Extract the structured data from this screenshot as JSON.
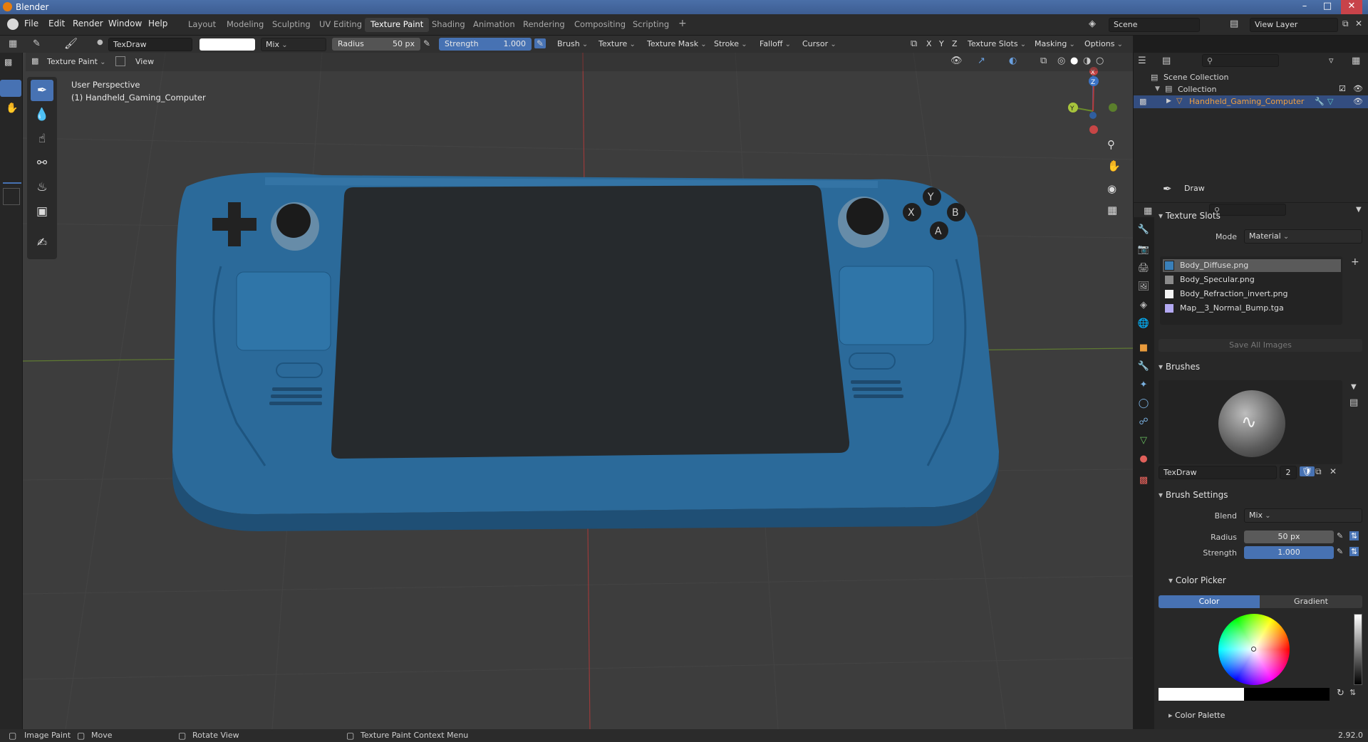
{
  "window": {
    "title": "Blender",
    "minimize": "–",
    "maximize": "□",
    "close": "✕"
  },
  "menu": {
    "file": "File",
    "edit": "Edit",
    "render": "Render",
    "window": "Window",
    "help": "Help"
  },
  "workspaces": [
    "Layout",
    "Modeling",
    "Sculpting",
    "UV Editing",
    "Texture Paint",
    "Shading",
    "Animation",
    "Rendering",
    "Compositing",
    "Scripting"
  ],
  "workspace_add": "+",
  "scene": {
    "scene_name": "Scene",
    "view_layer": "View Layer"
  },
  "toolheader": {
    "brush_name": "TexDraw",
    "blend": "Mix",
    "radius_label": "Radius",
    "radius_value": "50 px",
    "strength_label": "Strength",
    "strength_value": "1.000",
    "brush": "Brush",
    "texture": "Texture",
    "texture_mask": "Texture Mask",
    "stroke": "Stroke",
    "falloff": "Falloff",
    "cursor": "Cursor",
    "x": "X",
    "y": "Y",
    "z": "Z",
    "texture_slots": "Texture Slots",
    "masking": "Masking",
    "options": "Options"
  },
  "viewport_header": {
    "mode": "Texture Paint",
    "view": "View"
  },
  "viewport": {
    "perspective": "User Perspective",
    "object": "(1) Handheld_Gaming_Computer"
  },
  "gizmo": {
    "x": "X",
    "y": "Y",
    "z": "Z"
  },
  "outliner": {
    "scene_collection": "Scene Collection",
    "collection": "Collection",
    "object": "Handheld_Gaming_Computer"
  },
  "properties": {
    "tool_name": "Draw",
    "texture_slots_title": "Texture Slots",
    "mode_label": "Mode",
    "mode_value": "Material",
    "slots": [
      {
        "name": "Body_Diffuse.png",
        "color": "#3a7fb8"
      },
      {
        "name": "Body_Specular.png",
        "color": "#8a8a8a"
      },
      {
        "name": "Body_Refraction_invert.png",
        "color": "#f4f4f4"
      },
      {
        "name": "Map__3_Normal_Bump.tga",
        "color": "#b3a9f2"
      }
    ],
    "save_all": "Save All Images",
    "brushes_title": "Brushes",
    "brush_name": "TexDraw",
    "brush_users": "2",
    "brush_settings_title": "Brush Settings",
    "blend_label": "Blend",
    "blend_value": "Mix",
    "radius_label": "Radius",
    "radius_value": "50 px",
    "strength_label": "Strength",
    "strength_value": "1.000",
    "color_picker_title": "Color Picker",
    "color_tab": "Color",
    "gradient_tab": "Gradient",
    "color_palette_title": "Color Palette"
  },
  "statusbar": {
    "left_action": "Image Paint",
    "middle_action": "Move",
    "rotate": "Rotate View",
    "context": "Texture Paint Context Menu",
    "version": "2.92.0"
  },
  "colors": {
    "accent": "#4772b3",
    "device_body": "#2b6a9a",
    "screen": "#262a2d"
  }
}
